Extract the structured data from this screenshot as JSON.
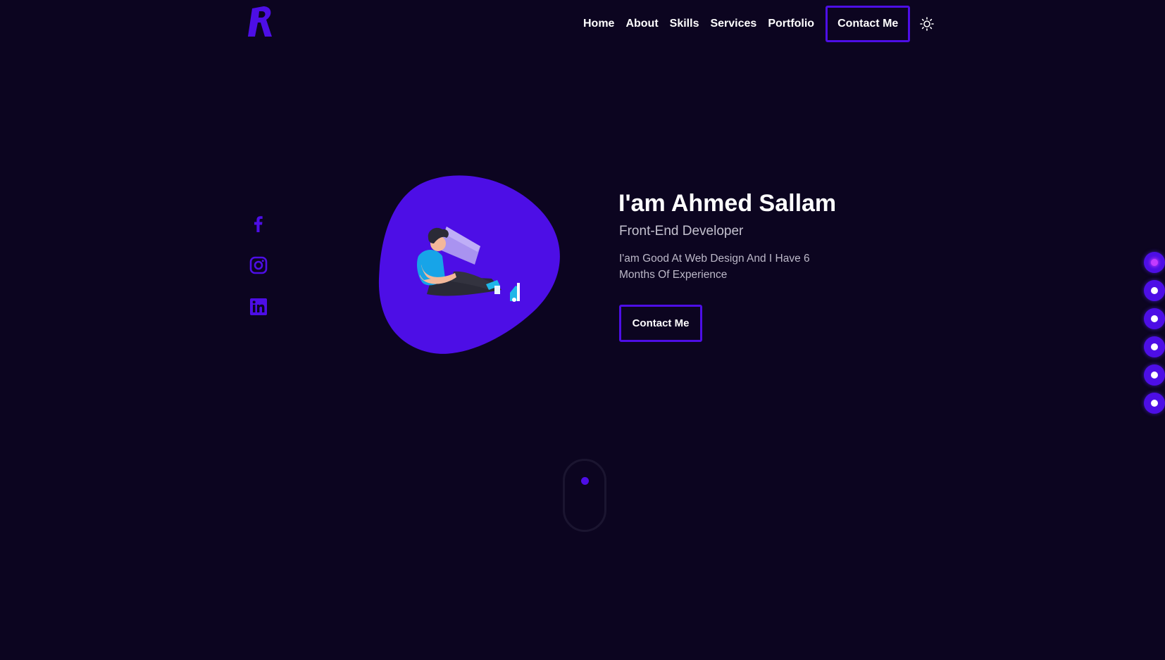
{
  "header": {
    "logo_icon": "r-logo-icon",
    "nav": [
      "Home",
      "About",
      "Skills",
      "Services",
      "Portfolio"
    ],
    "cta_label": "Contact Me",
    "theme_icon": "sun-icon"
  },
  "social": [
    "facebook-icon",
    "instagram-icon",
    "linkedin-icon"
  ],
  "hero": {
    "title": "I'am Ahmed Sallam",
    "subtitle": "Front-End Developer",
    "description": "I'am Good At Web Design And I Have 6 Months Of Experience",
    "cta_label": "Contact Me",
    "illustration": "developer-with-laptop-illustration"
  },
  "section_dots": {
    "count": 6,
    "active_index": 0
  },
  "colors": {
    "background": "#0c0520",
    "accent": "#4d0ee6",
    "text": "#ffffff",
    "muted_text": "#c4c1cf"
  }
}
